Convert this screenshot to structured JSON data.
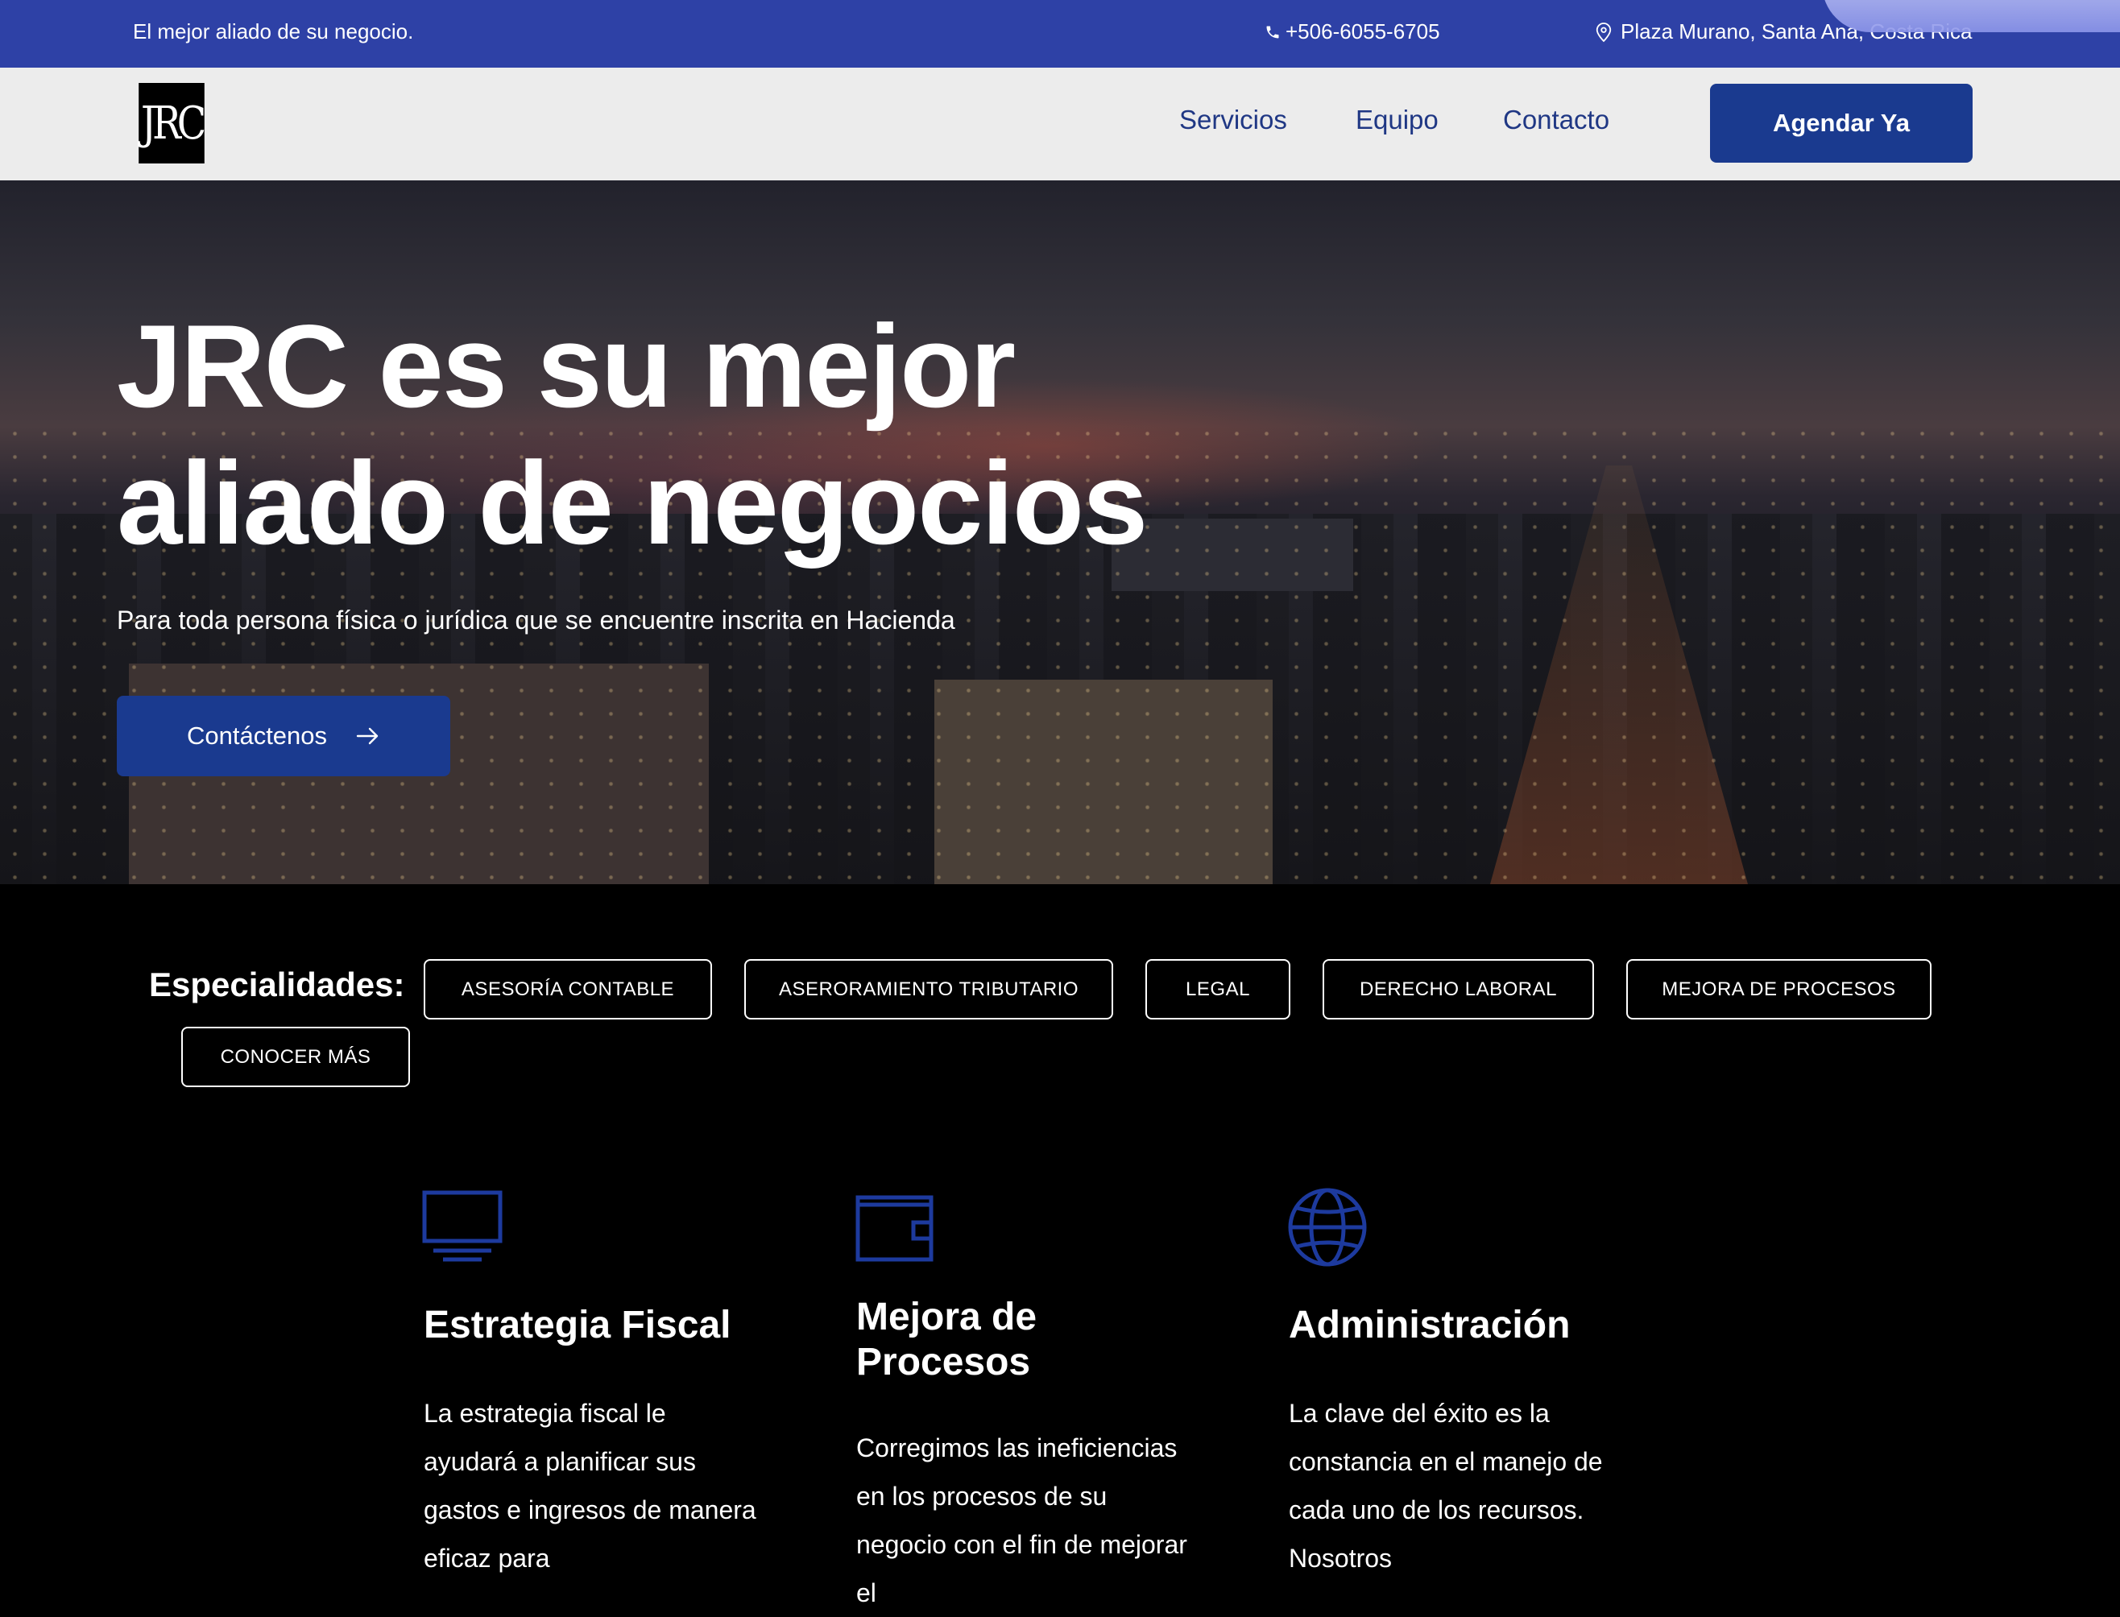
{
  "topbar": {
    "tagline": "El mejor aliado de su negocio.",
    "phone": "+506-6055-6705",
    "address": "Plaza Murano, Santa Ana, Costa Rica"
  },
  "nav": {
    "logo_text": "JRC",
    "links": [
      "Servicios",
      "Equipo",
      "Contacto"
    ],
    "cta": "Agendar Ya"
  },
  "hero": {
    "title_line1": "JRC es su mejor",
    "title_line2": "aliado de negocios",
    "subtitle": "Para toda persona física o jurídica que se encuentre inscrita en Hacienda",
    "button": "Contáctenos"
  },
  "specialties": {
    "label": "Especialidades:",
    "chips": [
      "ASESORÍA CONTABLE",
      "ASERORAMIENTO TRIBUTARIO",
      "LEGAL",
      "DERECHO LABORAL",
      "MEJORA DE PROCESOS",
      "CONOCER MÁS"
    ]
  },
  "services": [
    {
      "icon": "monitor-icon",
      "title": "Estrategia Fiscal",
      "text": "La estrategia fiscal le ayudará a planificar sus gastos e ingresos de manera eficaz para"
    },
    {
      "icon": "wallet-icon",
      "title": "Mejora de Procesos",
      "text": "Corregimos las ineficiencias en los procesos de su negocio con el fin de mejorar el"
    },
    {
      "icon": "globe-icon",
      "title": "Administración",
      "text": "La clave del éxito es la constancia en el manejo de cada uno de los recursos. Nosotros"
    }
  ],
  "colors": {
    "topbar": "#2e41a6",
    "brand_blue": "#1a3a8f",
    "nav_link": "#1f3784",
    "icon_blue": "#1d3a9e"
  }
}
